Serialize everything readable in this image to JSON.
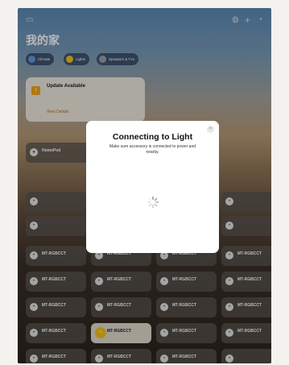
{
  "home": {
    "title": "我的家"
  },
  "chips": [
    {
      "label": "Climate",
      "sub": "",
      "color": "#5f9be0"
    },
    {
      "label": "Lights",
      "sub": "",
      "color": "#f0c030"
    },
    {
      "label": "Speakers & TVs",
      "sub": "",
      "color": "#9aa3ad"
    }
  ],
  "update_card": {
    "title": "Update Available",
    "line1": "",
    "line2": "",
    "link": "View Details"
  },
  "sections": {
    "s1": "",
    "s2": ""
  },
  "homepod": {
    "name": "HomePod",
    "status": ""
  },
  "accessories": [
    {
      "name": "",
      "status": ""
    },
    {
      "name": "",
      "status": ""
    },
    {
      "name": "",
      "status": ""
    },
    {
      "name": "",
      "status": ""
    },
    {
      "name": "MT-RGBCCT",
      "status": ""
    },
    {
      "name": "MT-RGBCCT",
      "status": ""
    },
    {
      "name": "MT-RGBCCT",
      "status": ""
    },
    {
      "name": "MT-RGBCCT",
      "status": ""
    },
    {
      "name": "MT-RGBCCT",
      "status": ""
    },
    {
      "name": "MT-RGBCCT",
      "status": ""
    },
    {
      "name": "MT-RGBCCT",
      "status": ""
    },
    {
      "name": "MT-RGBCCT",
      "status": ""
    },
    {
      "name": "MT-RGBCCT",
      "status": ""
    },
    {
      "name": "MT-RGBCCT",
      "status": ""
    },
    {
      "name": "MT-RGBCCT",
      "status": ""
    },
    {
      "name": "MT-RGBCCT",
      "status": ""
    },
    {
      "name": "MT-RGBCCT",
      "status": ""
    },
    {
      "name": "MT-RGBCCT",
      "status": ""
    },
    {
      "name": "MT-RGBCCT",
      "status": ""
    },
    {
      "name": "MT-RGBCCT",
      "status": ""
    },
    {
      "name": "MT-RGBCCT",
      "status": ""
    },
    {
      "name": "MT-RGBCCT",
      "status": ""
    },
    {
      "name": "MT-RGBCCT",
      "status": ""
    },
    {
      "name": "",
      "status": ""
    }
  ],
  "dialog": {
    "title": "Connecting to Light",
    "message": "Make sure accessory is connected to power and nearby."
  }
}
